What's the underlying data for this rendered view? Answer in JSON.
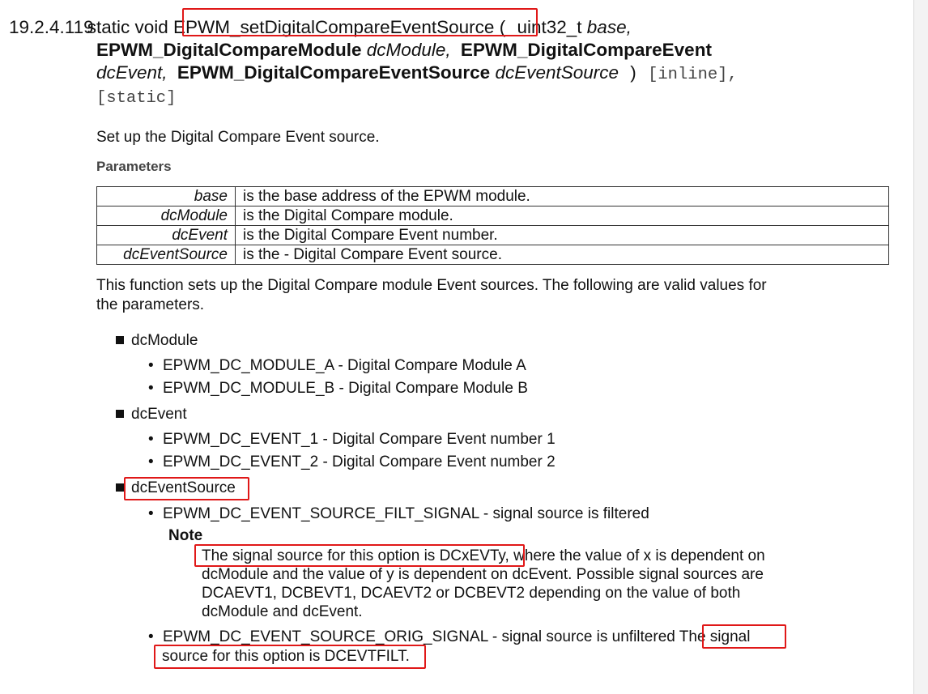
{
  "header": {
    "number": "19.2.4.119",
    "prefix": "static void",
    "function_name": "EPWM_setDigitalCompareEventSource",
    "open_paren": "(",
    "arg1_type": "uint32_t",
    "arg1_name": "base,",
    "arg2_type": "EPWM_DigitalCompareModule",
    "arg2_name": "dcModule,",
    "arg3_type": "EPWM_DigitalCompareEvent",
    "arg3_name": "dcEvent,",
    "arg4_type": "EPWM_DigitalCompareEventSource",
    "arg4_name": "dcEventSource",
    "close_paren": ")",
    "qualifier1": "[inline],",
    "qualifier2": "[static]"
  },
  "summary": "Set up the Digital Compare Event source.",
  "parameters": {
    "heading": "Parameters",
    "rows": [
      {
        "name": "base",
        "desc": "is the base address of the EPWM module."
      },
      {
        "name": "dcModule",
        "desc": "is the Digital Compare module."
      },
      {
        "name": "dcEvent",
        "desc": "is the Digital Compare Event number."
      },
      {
        "name": "dcEventSource",
        "desc": "is the - Digital Compare Event source."
      }
    ]
  },
  "description": {
    "line1": "This function sets up the Digital Compare module Event sources. The following are valid values for",
    "line2": "the parameters."
  },
  "list": {
    "dcModule": {
      "label": "dcModule",
      "items": [
        "EPWM_DC_MODULE_A - Digital Compare Module A",
        "EPWM_DC_MODULE_B - Digital Compare Module B"
      ]
    },
    "dcEvent": {
      "label": "dcEvent",
      "items": [
        "EPWM_DC_EVENT_1 - Digital Compare Event number 1",
        "EPWM_DC_EVENT_2 - Digital Compare Event number 2"
      ]
    },
    "dcEventSource": {
      "label": "dcEventSource",
      "item1": "EPWM_DC_EVENT_SOURCE_FILT_SIGNAL - signal source is filtered",
      "note_heading": "Note",
      "note_line1_a": "The signal source for this option is DCxEVTy,",
      "note_line1_b": " where the value of x is dependent on",
      "note_line2": "dcModule and the value of y is dependent on dcEvent. Possible signal sources are",
      "note_line3": "DCAEVT1, DCBEVT1, DCAEVT2 or DCBEVT2 depending on the value of both",
      "note_line4": "dcModule and dcEvent.",
      "item2_a": "EPWM_DC_EVENT_SOURCE_ORIG_SIGNAL - signal source is unfiltered ",
      "item2_b": "The signal",
      "item2_c": "source for this option is DCEVTFILT."
    }
  },
  "colors": {
    "highlight_box": "#e01818",
    "text": "#111111",
    "muted_text": "#444444"
  }
}
